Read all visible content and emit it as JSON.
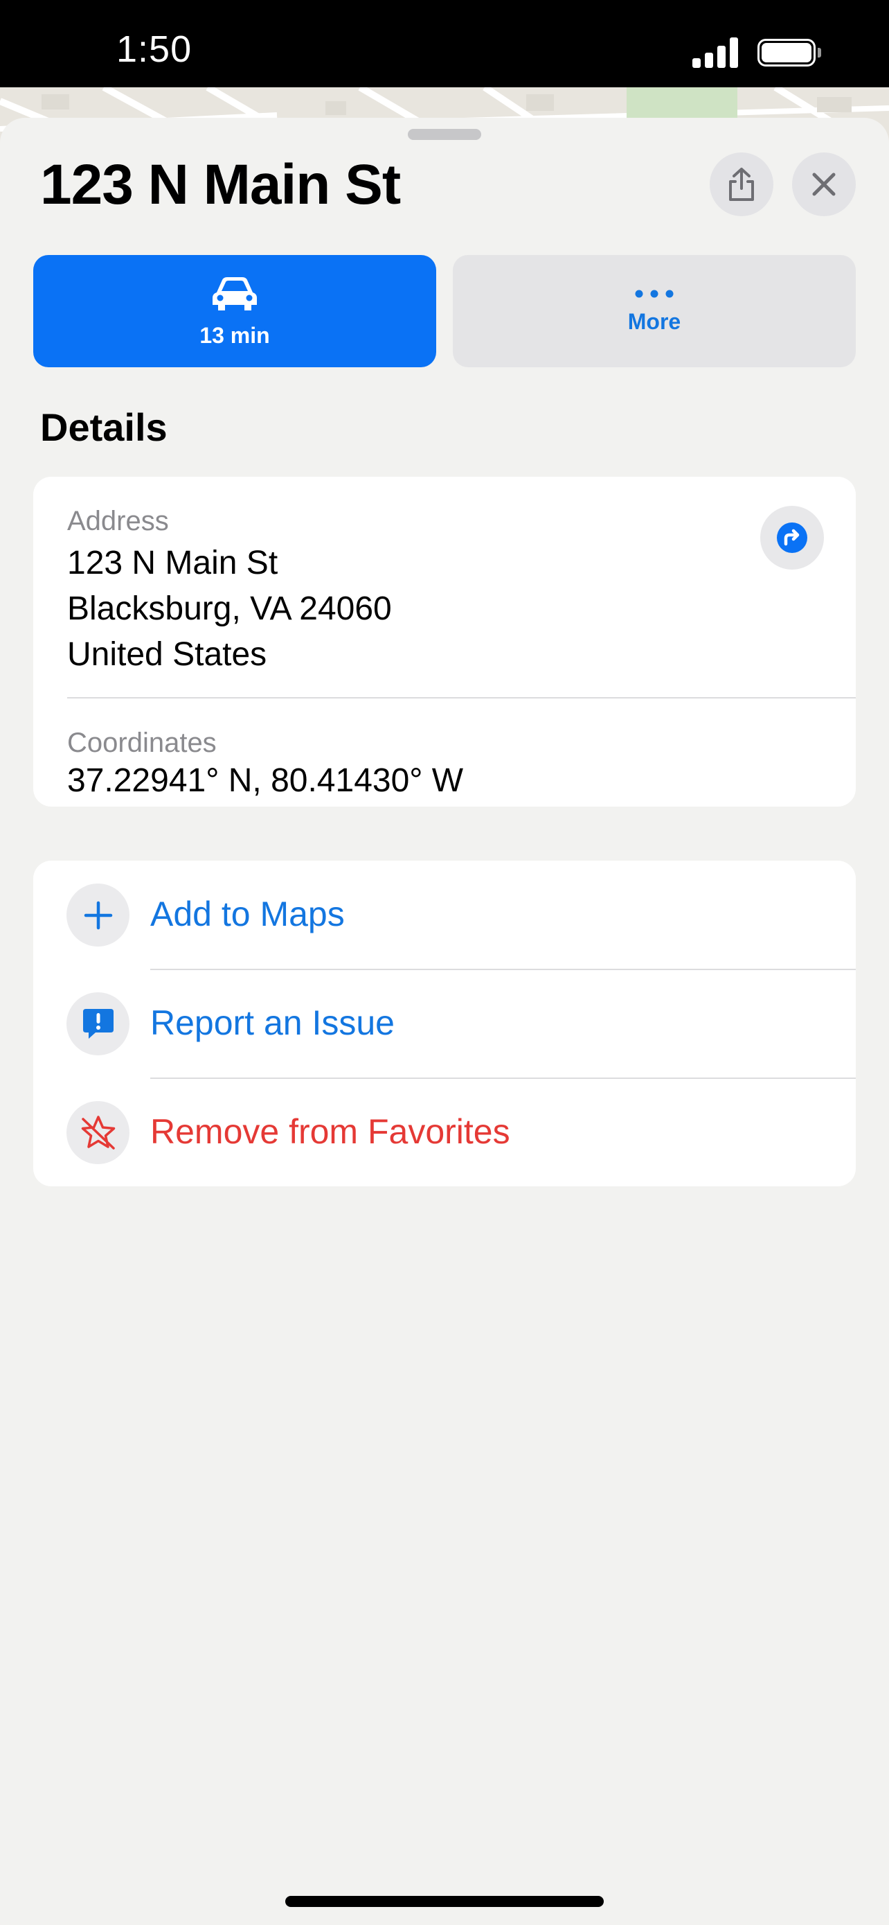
{
  "status_bar": {
    "time": "1:50"
  },
  "sheet": {
    "title": "123 N Main St",
    "share_icon": "share-icon",
    "close_icon": "close-icon"
  },
  "actions": {
    "drive": {
      "label": "13 min",
      "icon": "car-icon"
    },
    "more": {
      "label": "More",
      "icon": "ellipsis-icon"
    }
  },
  "details": {
    "section_title": "Details",
    "address": {
      "label": "Address",
      "line1": "123 N Main St",
      "line2": "Blacksburg, VA  24060",
      "line3": "United States"
    },
    "coordinates": {
      "label": "Coordinates",
      "value": "37.22941° N, 80.41430° W"
    }
  },
  "list": {
    "add_to_maps": "Add to Maps",
    "report_issue": "Report an Issue",
    "remove_favorites": "Remove from Favorites"
  },
  "colors": {
    "accent_blue": "#0A72F5",
    "link_blue": "#1376E0",
    "destructive_red": "#E53935",
    "sheet_background": "#F2F2F0"
  }
}
